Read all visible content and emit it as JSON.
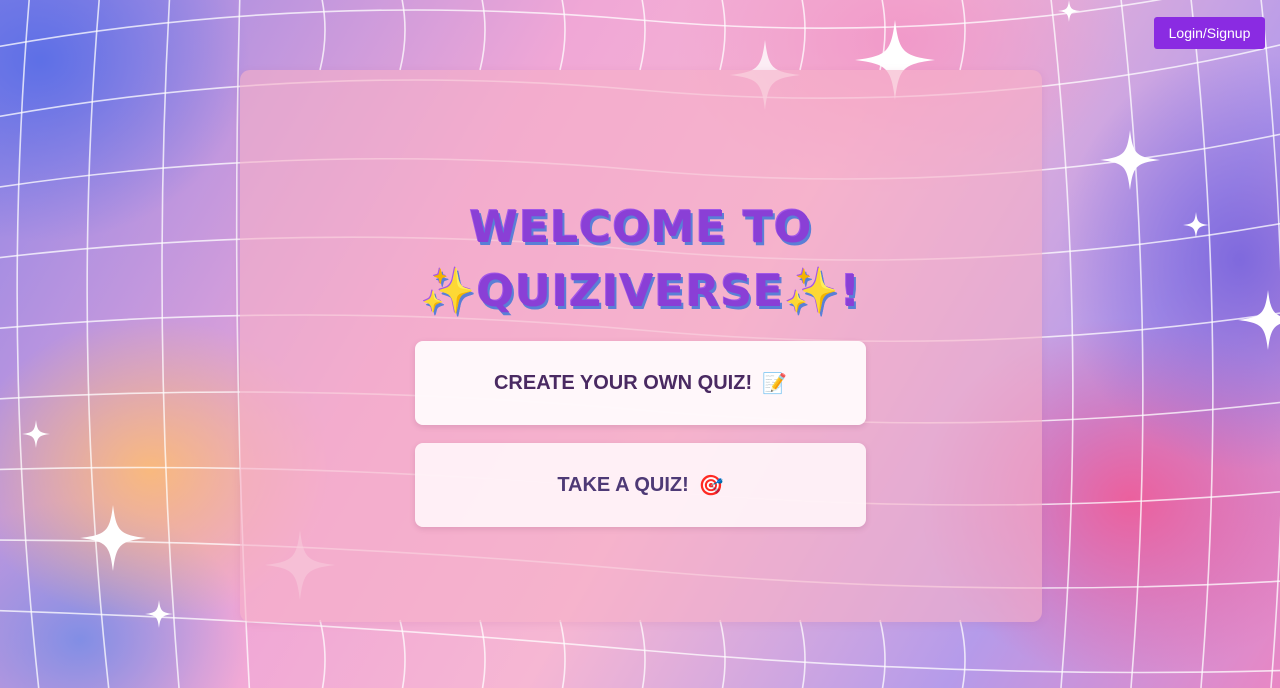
{
  "header": {
    "login_label": "Login/Signup"
  },
  "hero": {
    "title_line1": "WELCOME TO",
    "title_line2": "✨QUIZIVERSE✨!"
  },
  "actions": {
    "create_label": "CREATE YOUR OWN QUIZ!",
    "create_icon": "📝",
    "take_label": "TAKE A QUIZ!",
    "take_icon": "🎯"
  },
  "colors": {
    "login_button": "#8a2be2",
    "title": "#8a3fd6",
    "title_shadow": "#5a7fd6",
    "button_text": "#4a2a62"
  },
  "icons": {
    "create": "memo-icon",
    "take": "target-icon"
  }
}
